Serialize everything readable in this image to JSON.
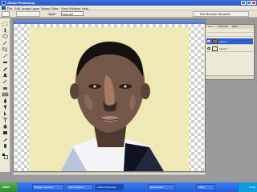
{
  "window": {
    "title": "Adobe Photoshop"
  },
  "menu": [
    "File",
    "Edit",
    "Image",
    "Layer",
    "Select",
    "Filter",
    "View",
    "Window",
    "Help"
  ],
  "options": {
    "mode_label": "Style:",
    "mode_value": "Normal",
    "palette_well": "File Browser  Brushes"
  },
  "document": {
    "title": "..."
  },
  "layers_panel": {
    "tabs": [
      "Layers",
      "Channels",
      "Paths"
    ],
    "layers": [
      {
        "name": "Layer 6",
        "selected": true
      },
      {
        "name": "Layer 5",
        "selected": false
      }
    ]
  },
  "taskbar": {
    "start": "start",
    "tasks": [
      "Blogger: Hexrokz",
      "Yash Folkslore",
      "Adobe Photoshop",
      "jobertutorial",
      "Tilmer"
    ],
    "clock": "00:24"
  },
  "colors": {
    "accent": "#2456c8",
    "canvas_bg": "#efe9b6",
    "taskbar": "#235fdb"
  }
}
